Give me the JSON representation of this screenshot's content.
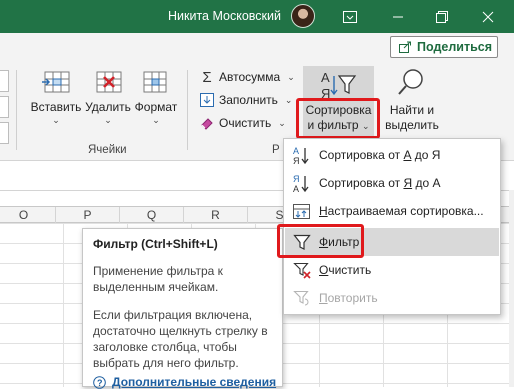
{
  "titlebar": {
    "user_name": "Никита Московский",
    "colors": {
      "bg": "#217346"
    },
    "icons": [
      "user-avatar",
      "ribbon-display-options-icon",
      "minimize-icon",
      "restore-icon",
      "close-icon"
    ]
  },
  "ribbon": {
    "share_label": "Поделиться",
    "cells_group": {
      "label": "Ячейки",
      "insert": "Вставить",
      "delete": "Удалить",
      "format": "Формат"
    },
    "editing_group": {
      "label_partial": "Р",
      "autosum": "Автосумма",
      "fill": "Заполнить",
      "clear": "Очистить",
      "sort_filter_line1": "Сортировка",
      "sort_filter_line2": "и фильтр",
      "find_select_line1": "Найти и",
      "find_select_line2": "выделить"
    }
  },
  "sheet": {
    "columns": [
      "O",
      "P",
      "Q",
      "R",
      "S"
    ]
  },
  "tooltip": {
    "title": "Фильтр (Ctrl+Shift+L)",
    "para1": "Применение фильтра к выделенным ячейкам.",
    "para2": "Если фильтрация включена, достаточно щелкнуть стрелку в заголовке столбца, чтобы выбрать для него фильтр.",
    "more": "Дополнительные сведения"
  },
  "menu": {
    "items": [
      {
        "pre": "Сортировка от ",
        "u": "А",
        "post": " до Я",
        "icon": "sort-a-z-icon",
        "state": "normal"
      },
      {
        "pre": "Сортировка от ",
        "u": "Я",
        "post": " до А",
        "icon": "sort-z-a-icon",
        "state": "normal"
      },
      {
        "pre": "",
        "u": "Н",
        "post": "астраиваемая сортировка...",
        "icon": "custom-sort-icon",
        "state": "normal"
      },
      {
        "pre": "",
        "u": "Ф",
        "post": "ильтр",
        "icon": "filter-icon",
        "state": "hover"
      },
      {
        "pre": "",
        "u": "О",
        "post": "чистить",
        "icon": "clear-filter-icon",
        "state": "normal"
      },
      {
        "pre": "",
        "u": "П",
        "post": "овторить",
        "icon": "reapply-filter-icon",
        "state": "disabled"
      }
    ]
  },
  "accent": {
    "highlight_red": "#e0191c",
    "link_blue": "#1f5fa0",
    "brand_green": "#217346"
  }
}
